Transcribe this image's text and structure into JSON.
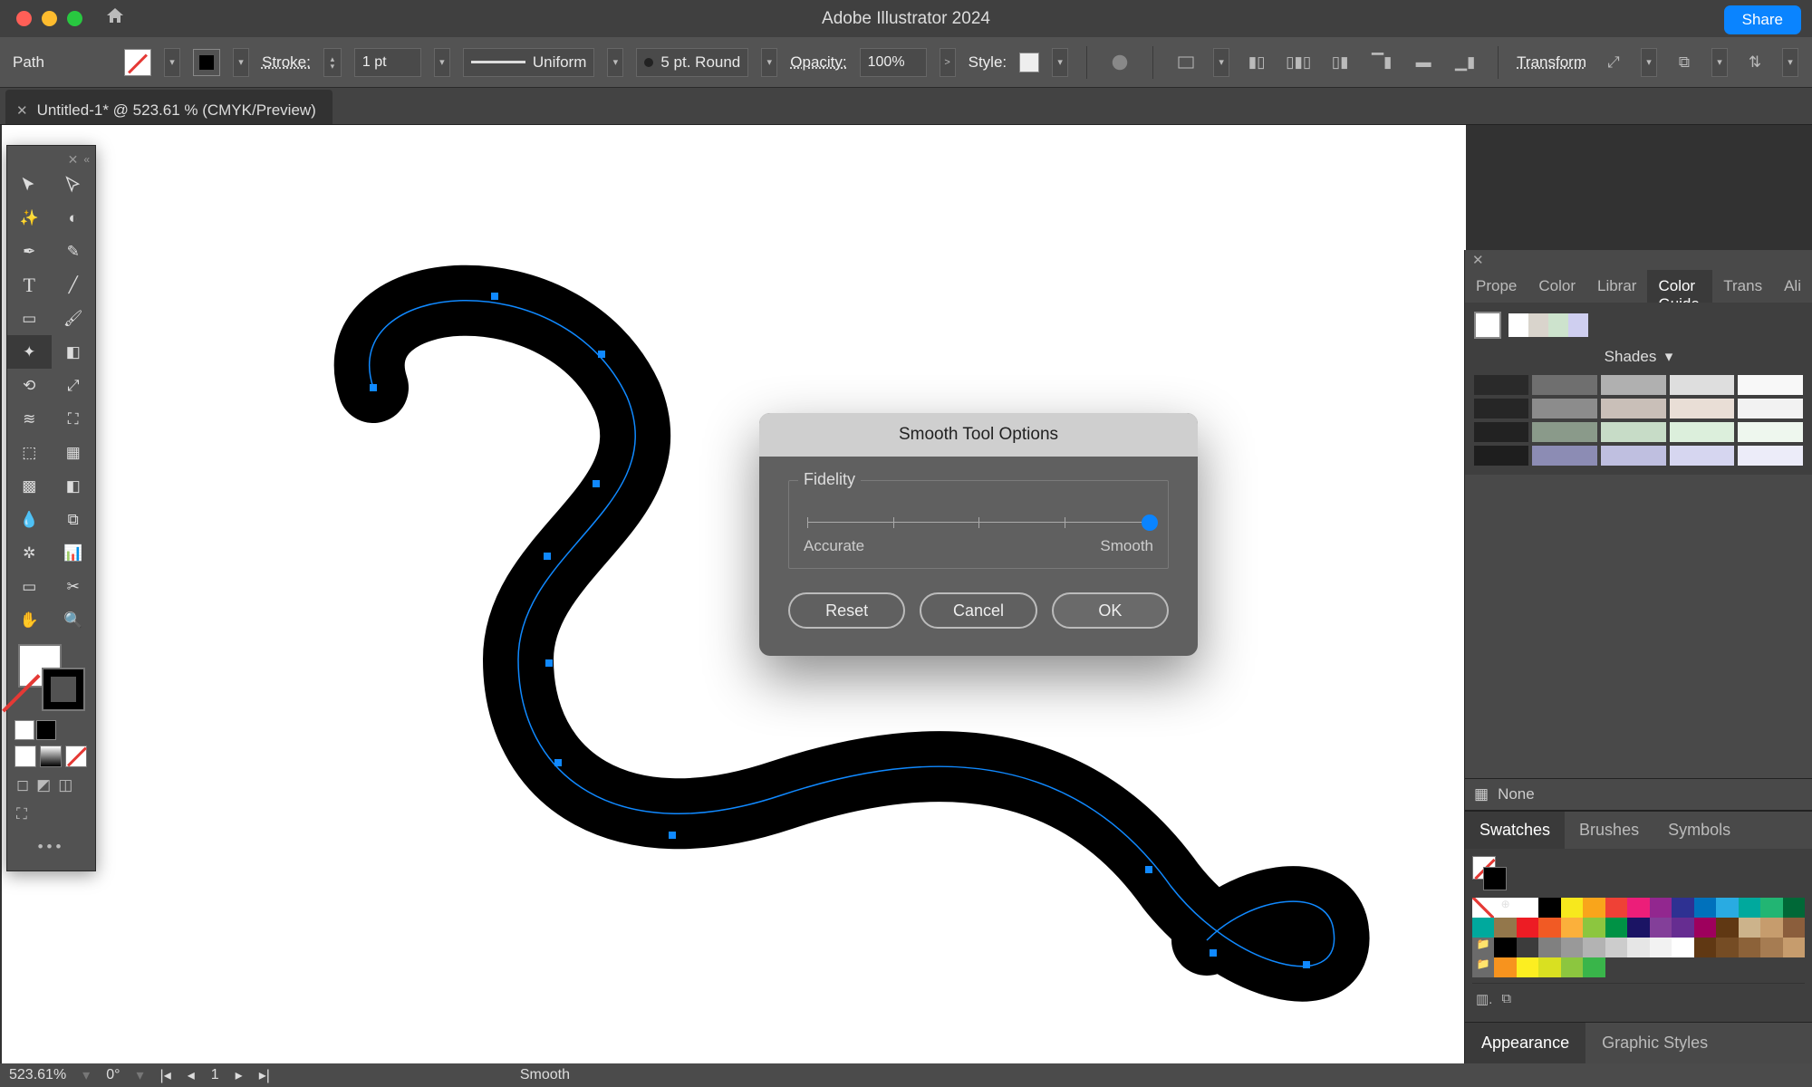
{
  "app": {
    "title": "Adobe Illustrator 2024",
    "share_label": "Share"
  },
  "controlbar": {
    "selection_label": "Path",
    "stroke_label": "Stroke:",
    "stroke_value": "1 pt",
    "profile_label": "Uniform",
    "brush_label": "5 pt. Round",
    "opacity_label": "Opacity:",
    "opacity_value": "100%",
    "style_label": "Style:",
    "transform_label": "Transform"
  },
  "document_tab": {
    "title": "Untitled-1* @ 523.61 % (CMYK/Preview)"
  },
  "right_panel": {
    "top_tabs": [
      "Prope",
      "Color",
      "Librar",
      "Color Guide",
      "Trans",
      "Ali"
    ],
    "active_top_tab": 3,
    "shades_label": "Shades",
    "none_label": "None",
    "mid_tabs": [
      "Swatches",
      "Brushes",
      "Symbols"
    ],
    "active_mid_tab": 0,
    "bottom_tabs": [
      "Appearance",
      "Graphic Styles"
    ],
    "active_bottom_tab": 0
  },
  "dialog": {
    "title": "Smooth Tool Options",
    "group_label": "Fidelity",
    "min_label": "Accurate",
    "max_label": "Smooth",
    "value_pct": 100,
    "buttons": {
      "reset": "Reset",
      "cancel": "Cancel",
      "ok": "OK"
    }
  },
  "statusbar": {
    "zoom": "523.61%",
    "rotate": "0°",
    "artboard": "1",
    "tool": "Smooth"
  },
  "colors": {
    "shade_rows": [
      [
        "#2a2a2a",
        "#6f6f6f",
        "#b0b0b0",
        "#dedede",
        "#f8f8f8"
      ],
      [
        "#262626",
        "#8c8c8c",
        "#c9bfb8",
        "#e9ded6",
        "#f2f2f2"
      ],
      [
        "#222222",
        "#8a9a8a",
        "#c7dcc7",
        "#dcefdc",
        "#eef7ee"
      ],
      [
        "#1e1e1e",
        "#8c8cb4",
        "#bfbfe0",
        "#d6d6f0",
        "#ececf9"
      ]
    ],
    "guide_chips": [
      "#ffffff",
      "#d9d4cc",
      "#cde3cd",
      "#cfcff0"
    ],
    "swatches": [
      [
        "none",
        "reg",
        "#ffffff",
        "#000000",
        "#f7e81d",
        "#f9a51b",
        "#ef4136",
        "#ec1e79",
        "#92278f",
        "#2e3192",
        "#0071bc",
        "#29abe2",
        "#00a99d",
        "#22b573",
        "#006837"
      ],
      [
        "#00a99d",
        "#93774b",
        "#ed1c24",
        "#f15a24",
        "#fbb03b",
        "#8cc63f",
        "#009245",
        "#1b1464",
        "#833f99",
        "#662d91",
        "#9e005d",
        "#603813",
        "#ccb38b",
        "#c69c6d",
        "#8b5e3c"
      ],
      [
        "folder",
        "#000000",
        "#3c3c3c",
        "#808080",
        "#999999",
        "#b3b3b3",
        "#cccccc",
        "#e6e6e6",
        "#f2f2f2",
        "#ffffff",
        "#603813",
        "#754c24",
        "#8c6239",
        "#a67c52",
        "#c69c6d"
      ],
      [
        "folder",
        "#f7931e",
        "#fcee21",
        "#d9e021",
        "#8cc63f",
        "#39b54a",
        "",
        "",
        "",
        "",
        "",
        "",
        "",
        "",
        ""
      ]
    ]
  }
}
